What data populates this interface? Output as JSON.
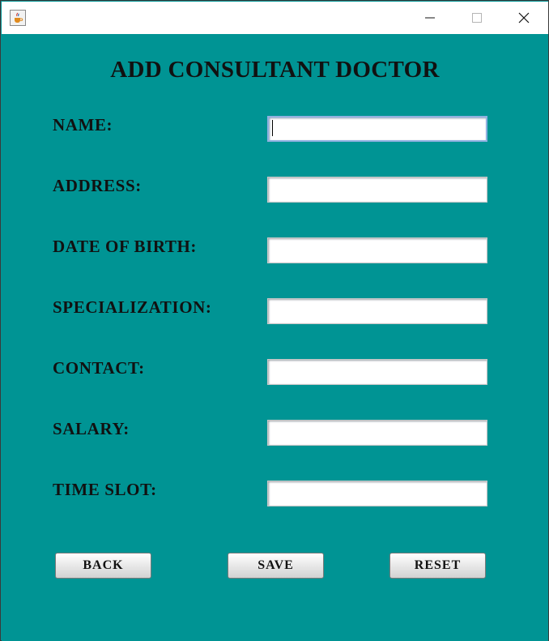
{
  "window": {
    "icon": "java-cup-icon",
    "controls": [
      "minimize-icon",
      "maximize-icon",
      "close-icon"
    ]
  },
  "form": {
    "title": "ADD CONSULTANT DOCTOR",
    "fields": [
      {
        "label": "NAME:",
        "value": ""
      },
      {
        "label": "ADDRESS:",
        "value": ""
      },
      {
        "label": "DATE OF BIRTH:",
        "value": ""
      },
      {
        "label": "SPECIALIZATION:",
        "value": ""
      },
      {
        "label": "CONTACT:",
        "value": ""
      },
      {
        "label": "SALARY:",
        "value": ""
      },
      {
        "label": "TIME SLOT:",
        "value": ""
      }
    ]
  },
  "buttons": {
    "back": "BACK",
    "save": "SAVE",
    "reset": "RESET"
  },
  "colors": {
    "background": "#009494",
    "titlebar": "#ffffff",
    "text": "#111111"
  }
}
